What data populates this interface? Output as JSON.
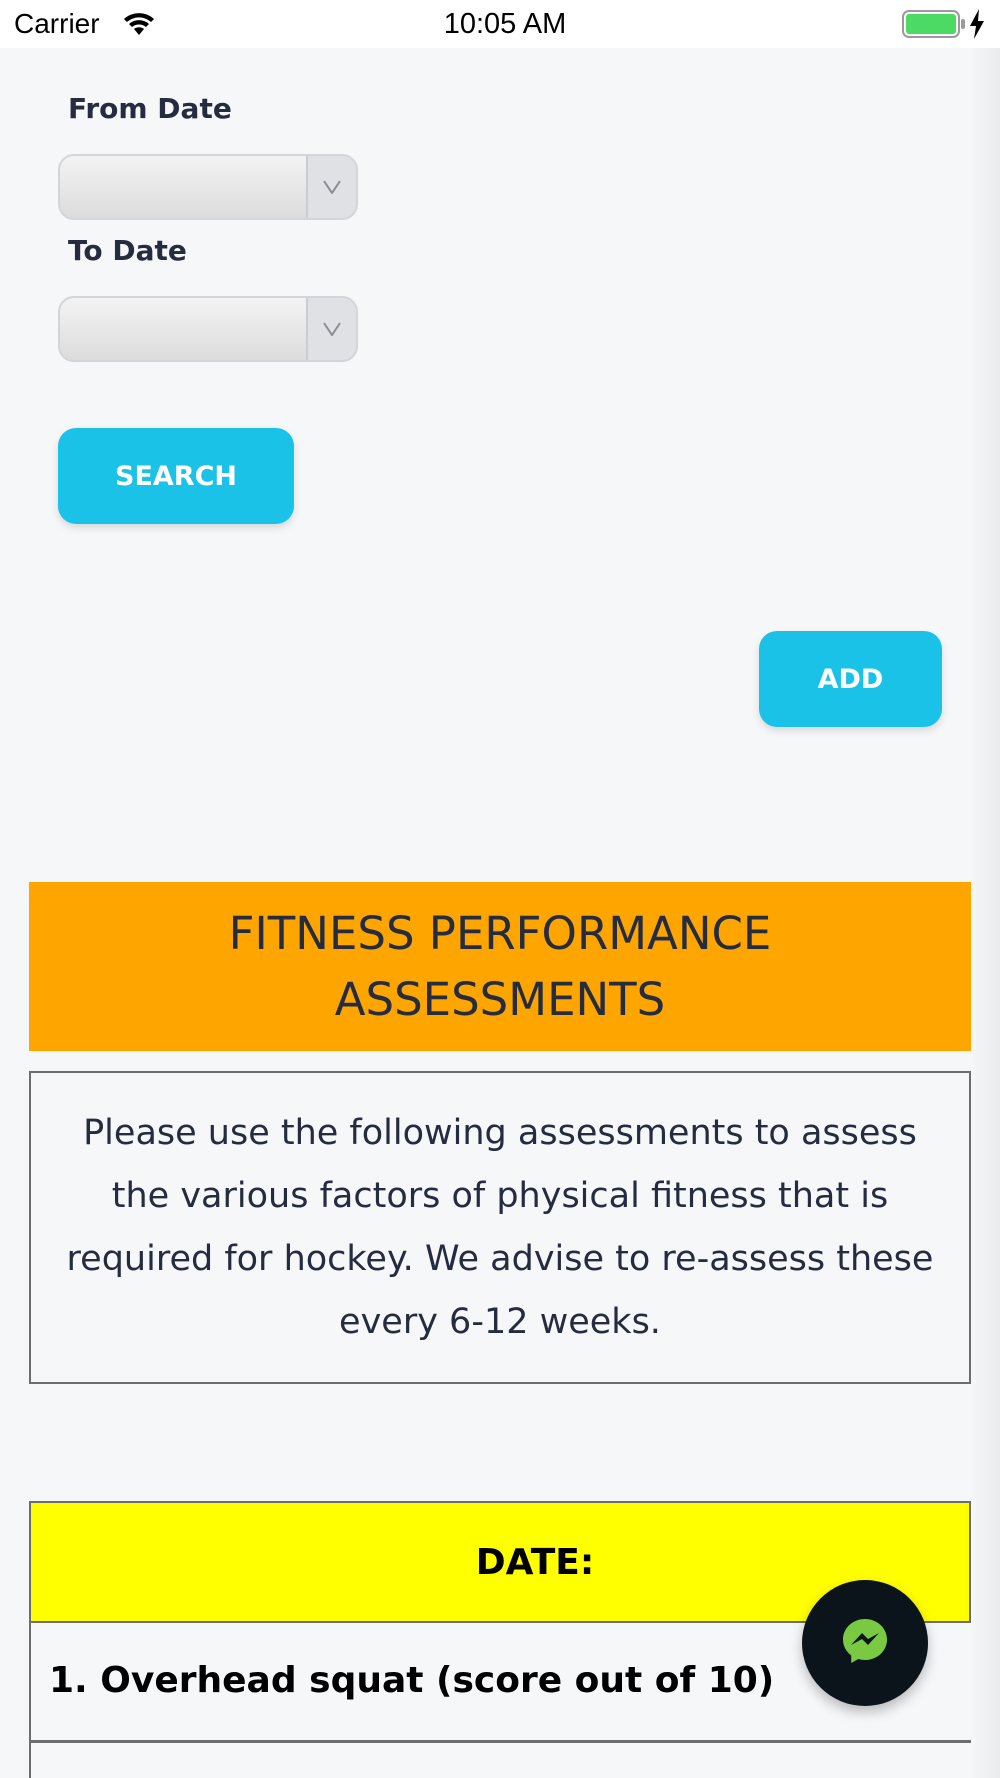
{
  "status_bar": {
    "carrier": "Carrier",
    "time": "10:05 AM",
    "battery_color": "#4cd964"
  },
  "filters": {
    "from_label": "From Date",
    "from_value": "",
    "to_label": "To Date",
    "to_value": "",
    "search_label": "SEARCH"
  },
  "actions": {
    "add_label": "ADD"
  },
  "banner": {
    "title": "FITNESS PERFORMANCE ASSESSMENTS",
    "color": "#ffa500"
  },
  "info": {
    "text": "Please use the following assessments to assess the various factors of physical fitness that is required for hockey. We advise to re-assess these every 6-12 weeks."
  },
  "table": {
    "header": "DATE:",
    "header_color": "#ffff00",
    "rows": [
      {
        "label": "1. Overhead squat (score out of 10)"
      }
    ]
  },
  "colors": {
    "accent": "#1bc2e8",
    "text": "#252c3f",
    "fab": "#0c141b",
    "messenger": "#7ac943"
  },
  "icons": {
    "fab": "messenger-icon",
    "select_arrow": "chevron-down-icon"
  }
}
